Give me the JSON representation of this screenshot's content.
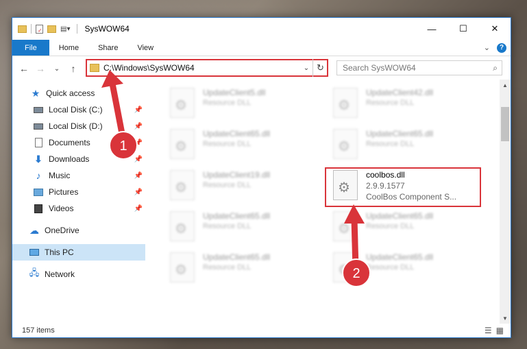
{
  "window": {
    "title": "SysWOW64",
    "controls": {
      "minimize": "—",
      "maximize": "☐",
      "close": "✕"
    }
  },
  "ribbon": {
    "tabs": [
      "File",
      "Home",
      "Share",
      "View"
    ],
    "expand": "⌄",
    "help": "?"
  },
  "address": {
    "path": "C:\\Windows\\SysWOW64",
    "refresh": "↻",
    "dropdown": "⌄"
  },
  "search": {
    "placeholder": "Search SysWOW64",
    "icon": "search-icon"
  },
  "nav_buttons": {
    "back": "←",
    "forward": "→",
    "recent": "⌄",
    "up": "↑"
  },
  "sidebar": {
    "items": [
      {
        "label": "Quick access",
        "icon": "star-icon",
        "pinned": false
      },
      {
        "label": "Local Disk (C:)",
        "icon": "drive-icon",
        "pinned": true
      },
      {
        "label": "Local Disk (D:)",
        "icon": "drive-icon",
        "pinned": true
      },
      {
        "label": "Documents",
        "icon": "document-icon",
        "pinned": true
      },
      {
        "label": "Downloads",
        "icon": "download-icon",
        "pinned": true
      },
      {
        "label": "Music",
        "icon": "music-icon",
        "pinned": true
      },
      {
        "label": "Pictures",
        "icon": "picture-icon",
        "pinned": true
      },
      {
        "label": "Videos",
        "icon": "video-icon",
        "pinned": true
      },
      {
        "label": "OneDrive",
        "icon": "cloud-icon",
        "pinned": false
      },
      {
        "label": "This PC",
        "icon": "pc-icon",
        "pinned": false,
        "selected": true
      },
      {
        "label": "Network",
        "icon": "network-icon",
        "pinned": false
      }
    ]
  },
  "files": {
    "col1": [
      {
        "name": "UpdateClient5.dll",
        "desc": "Resource DLL"
      },
      {
        "name": "UpdateClient65.dll",
        "desc": "Resource DLL"
      },
      {
        "name": "UpdateClient19.dll",
        "desc": "Resource DLL"
      },
      {
        "name": "UpdateClient65.dll",
        "desc": "Resource DLL"
      },
      {
        "name": "UpdateClient65.dll",
        "desc": "Resource DLL"
      }
    ],
    "col2": [
      {
        "name": "UpdateClient42.dll",
        "desc": "Resource DLL"
      },
      {
        "name": "UpdateClient65.dll",
        "desc": "Resource DLL"
      },
      {
        "name": "UpdateClient65.dll",
        "desc": "Resource DLL"
      },
      {
        "name": "UpdateClient65.dll",
        "desc": "Resource DLL"
      }
    ],
    "highlighted": {
      "name": "coolbos.dll",
      "version": "2.9.9.1577",
      "desc": "CoolBos Component S..."
    }
  },
  "status": {
    "count": "157 items"
  },
  "markers": [
    "1",
    "2"
  ],
  "colors": {
    "accent": "#1979ca",
    "highlight": "#d9343a"
  }
}
